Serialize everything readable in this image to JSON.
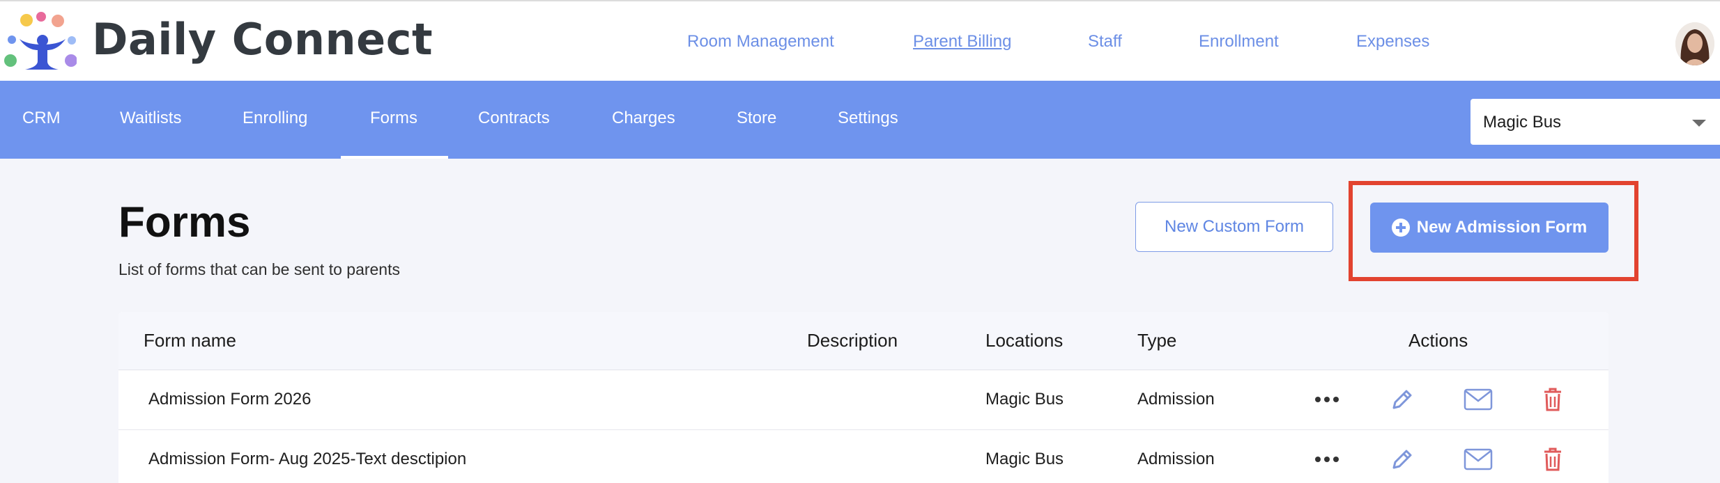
{
  "app": {
    "brand": "Daily Connect"
  },
  "top_nav": [
    {
      "label": "Room Management"
    },
    {
      "label": "Parent Billing",
      "underlined": true
    },
    {
      "label": "Staff"
    },
    {
      "label": "Enrollment"
    },
    {
      "label": "Expenses"
    }
  ],
  "sub_nav": {
    "items": [
      {
        "label": "CRM"
      },
      {
        "label": "Waitlists"
      },
      {
        "label": "Enrolling"
      },
      {
        "label": "Forms",
        "active": true
      },
      {
        "label": "Contracts"
      },
      {
        "label": "Charges"
      },
      {
        "label": "Store"
      },
      {
        "label": "Settings"
      }
    ],
    "location_select": "Magic Bus"
  },
  "page": {
    "title": "Forms",
    "subtitle": "List of forms that can be sent to parents",
    "new_custom_form": "New Custom Form",
    "new_admission_form": "New Admission Form"
  },
  "table": {
    "headers": {
      "form_name": "Form name",
      "description": "Description",
      "locations": "Locations",
      "type": "Type",
      "actions": "Actions"
    },
    "rows": [
      {
        "name": "Admission Form 2026",
        "description": "",
        "location": "Magic Bus",
        "type": "Admission"
      },
      {
        "name": "Admission Form- Aug 2025-Text desctipion",
        "description": "",
        "location": "Magic Bus",
        "type": "Admission"
      }
    ]
  },
  "colors": {
    "accent": "#6f94ee",
    "link": "#6c8fe6",
    "delete": "#e05a5a",
    "highlight": "#e2432f"
  }
}
